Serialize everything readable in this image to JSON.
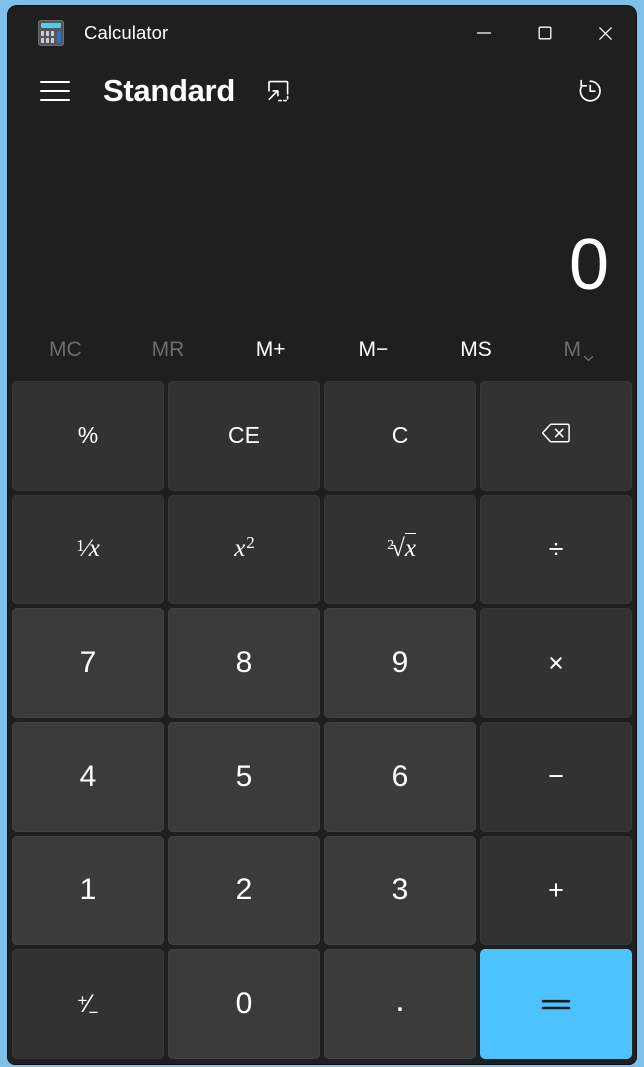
{
  "app": {
    "title": "Calculator",
    "icon": "calculator-app-icon",
    "accent_color": "#4cc2ff",
    "window_bg": "#1f1f1f",
    "key_bg": "#323232",
    "num_key_bg": "#3b3b3b",
    "desktop_bg": "#7fc0ea"
  },
  "window_controls": {
    "minimize": "minimize-icon",
    "maximize": "maximize-icon",
    "close": "close-icon"
  },
  "header": {
    "menu": "hamburger-menu-icon",
    "mode": "Standard",
    "keep_on_top": "keep-on-top-icon",
    "history": "history-icon"
  },
  "display": {
    "expression": "",
    "result": "0"
  },
  "memory": {
    "buttons": [
      {
        "label": "MC",
        "name": "memory-clear",
        "disabled": true
      },
      {
        "label": "MR",
        "name": "memory-recall",
        "disabled": true
      },
      {
        "label": "M+",
        "name": "memory-add",
        "disabled": false
      },
      {
        "label": "M−",
        "name": "memory-subtract",
        "disabled": false
      },
      {
        "label": "MS",
        "name": "memory-store",
        "disabled": false
      },
      {
        "label": "M",
        "name": "memory-dropdown",
        "disabled": true
      }
    ]
  },
  "keypad": {
    "rows": [
      [
        {
          "label": "%",
          "name": "percent",
          "type": "fn"
        },
        {
          "label": "CE",
          "name": "clear-entry",
          "type": "fn"
        },
        {
          "label": "C",
          "name": "clear",
          "type": "fn"
        },
        {
          "label": "",
          "name": "backspace",
          "type": "icon-backspace"
        }
      ],
      [
        {
          "label": "1/x",
          "name": "reciprocal",
          "type": "glyph-reciprocal"
        },
        {
          "label": "x2",
          "name": "square",
          "type": "glyph-square"
        },
        {
          "label": "2√x",
          "name": "square-root",
          "type": "glyph-sqrt"
        },
        {
          "label": "÷",
          "name": "divide",
          "type": "op"
        }
      ],
      [
        {
          "label": "7",
          "name": "seven",
          "type": "num"
        },
        {
          "label": "8",
          "name": "eight",
          "type": "num"
        },
        {
          "label": "9",
          "name": "nine",
          "type": "num"
        },
        {
          "label": "×",
          "name": "multiply",
          "type": "op"
        }
      ],
      [
        {
          "label": "4",
          "name": "four",
          "type": "num"
        },
        {
          "label": "5",
          "name": "five",
          "type": "num"
        },
        {
          "label": "6",
          "name": "six",
          "type": "num"
        },
        {
          "label": "−",
          "name": "minus",
          "type": "op"
        }
      ],
      [
        {
          "label": "1",
          "name": "one",
          "type": "num"
        },
        {
          "label": "2",
          "name": "two",
          "type": "num"
        },
        {
          "label": "3",
          "name": "three",
          "type": "num"
        },
        {
          "label": "+",
          "name": "plus",
          "type": "op"
        }
      ],
      [
        {
          "label": "+/−",
          "name": "negate",
          "type": "glyph-negate"
        },
        {
          "label": "0",
          "name": "zero",
          "type": "num"
        },
        {
          "label": ".",
          "name": "decimal",
          "type": "glyph-dot"
        },
        {
          "label": "=",
          "name": "equals",
          "type": "equals"
        }
      ]
    ]
  }
}
